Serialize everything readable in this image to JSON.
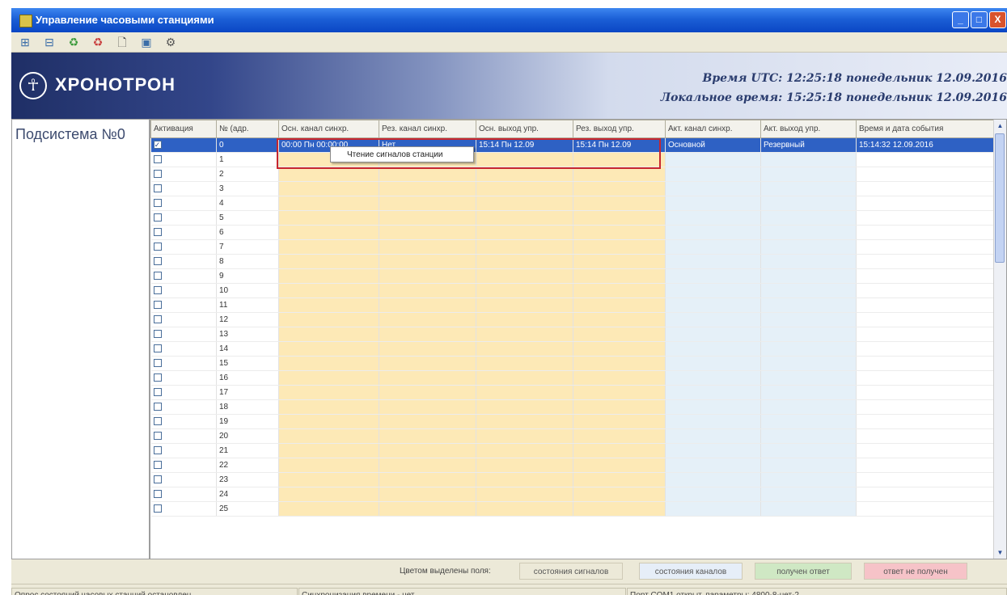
{
  "window": {
    "title": "Управление часовыми станциями"
  },
  "titlebar_buttons": {
    "minimize": "_",
    "maximize": "□",
    "close": "X"
  },
  "toolbar": [
    {
      "icon": "network-connect-icon",
      "glyph": "⊞",
      "color": "#3b6ea8"
    },
    {
      "icon": "network-disconnect-icon",
      "glyph": "⊟",
      "color": "#3b6ea8"
    },
    {
      "icon": "refresh-green-icon",
      "glyph": "♻",
      "color": "#3a9a3a"
    },
    {
      "icon": "refresh-red-icon",
      "glyph": "♻",
      "color": "#c83c3c"
    },
    {
      "icon": "new-document-icon",
      "glyph": "🗋",
      "color": "#444444"
    },
    {
      "icon": "window-icon",
      "glyph": "▣",
      "color": "#3b6ea8"
    },
    {
      "icon": "settings-tool-icon",
      "glyph": "⚙",
      "color": "#555555"
    }
  ],
  "banner": {
    "logo_text": "ХРОНОТРОН",
    "utc_line": "Время UTC: 12:25:18  понедельник 12.09.2016",
    "local_line": "Локальное время: 15:25:18  понедельник 12.09.2016"
  },
  "subsystems": [
    "Подсистема №0"
  ],
  "grid": {
    "columns": [
      "Активация",
      "№ (адр.",
      "Осн. канал синхр.",
      "Рез. канал синхр.",
      "Осн. выход упр.",
      "Рез. выход упр.",
      "Акт. канал синхр.",
      "Акт. выход упр.",
      "Время и дата события"
    ],
    "selected_row": {
      "checked": true,
      "num": "0",
      "osn_kanal": "00:00 Пн 00:00:00",
      "rez_kanal": "Нет",
      "osn_vyhod": "15:14 Пн 12.09",
      "rez_vyhod": "15:14 Пн 12.09",
      "akt_kanal": "Основной",
      "akt_vyhod": "Резервный",
      "event_time": "15:14:32 12.09.2016"
    },
    "row_numbers": [
      "1",
      "2",
      "3",
      "4",
      "5",
      "6",
      "7",
      "8",
      "9",
      "10",
      "11",
      "12",
      "13",
      "14",
      "15",
      "16",
      "17",
      "18",
      "19",
      "20",
      "21",
      "22",
      "23",
      "24",
      "25"
    ]
  },
  "context_menu": {
    "item": "Чтение сигналов станции"
  },
  "legend": {
    "label": "Цветом выделены поля:",
    "items": [
      {
        "text": "состояния сигналов",
        "color": "#ece9d8"
      },
      {
        "text": "состояния каналов",
        "color": "#e6eef8"
      },
      {
        "text": "получен ответ",
        "color": "#cfe8c4"
      },
      {
        "text": "ответ не получен",
        "color": "#f6c3c8"
      }
    ]
  },
  "statusbar": {
    "polling": "Опрос состояний часовых станций остановлен",
    "sync": "Синхронизация времени - нет",
    "port": "Порт COM1 открыт, параметры: 4800-8-нет-2"
  }
}
